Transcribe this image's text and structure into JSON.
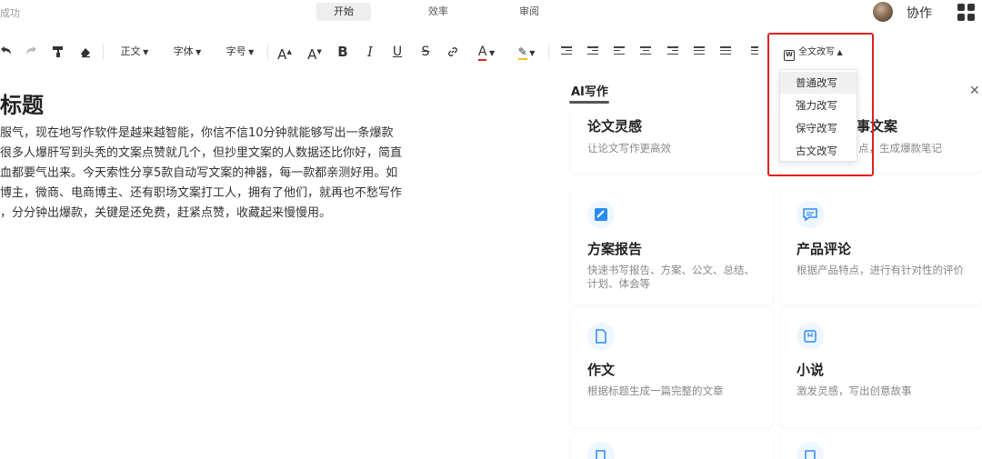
{
  "topbar": {
    "status": "成功",
    "tabs": [
      "开始",
      "效率",
      "审阅"
    ],
    "collab": "协作"
  },
  "toolbar": {
    "style": "正文",
    "font": "字体",
    "size": "字号",
    "grow": "A",
    "shrink": "A",
    "bold": "B",
    "italic": "I",
    "underline": "U",
    "strike": "S",
    "font_color": "A",
    "rewrite": "全文改写",
    "accent_color": "#e02020"
  },
  "document": {
    "title": "标题",
    "paragraph": [
      "服气，现在地写作软件是越来越智能，你信不信10分钟就能够写出一条爆款",
      "很多人爆肝写到头秃的文案点赞就几个，但抄里文案的人数据还比你好，简直",
      "血都要气出来。今天索性分享5款自动写文案的神器，每一款都亲测好用。如",
      "博主，微商、电商博主、还有职场文案打工人，拥有了他们，就再也不愁写作",
      "，分分钟出爆款，关键是还免费，赶紧点赞，收藏起来慢慢用。"
    ]
  },
  "ai_panel": {
    "header": "AI写作",
    "cards": [
      {
        "title": "论文灵感",
        "desc": "让论文写作更高效",
        "icon": "lightbulb-icon"
      },
      {
        "title": "事文案",
        "desc": "点，生成爆款笔记",
        "icon": "note-icon"
      },
      {
        "title": "方案报告",
        "desc": "快速书写报告、方案、公文、总结、计划、体会等",
        "icon": "report-icon"
      },
      {
        "title": "产品评论",
        "desc": "根据产品特点，进行有针对性的评价",
        "icon": "comment-icon"
      },
      {
        "title": "作文",
        "desc": "根据标题生成一篇完整的文章",
        "icon": "document-icon"
      },
      {
        "title": "小说",
        "desc": "激发灵感，写出创意故事",
        "icon": "book-icon"
      }
    ]
  },
  "dropdown": {
    "items": [
      "普通改写",
      "强力改写",
      "保守改写",
      "古文改写"
    ]
  }
}
